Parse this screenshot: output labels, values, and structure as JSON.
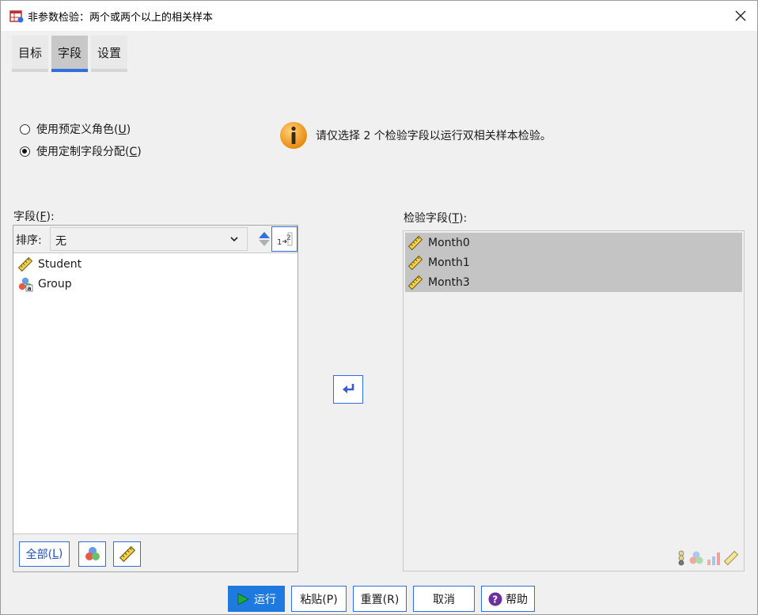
{
  "window": {
    "title": "非参数检验：两个或两个以上的相关样本"
  },
  "tabs": [
    {
      "label": "目标",
      "active": false
    },
    {
      "label": "字段",
      "active": true
    },
    {
      "label": "设置",
      "active": false
    }
  ],
  "roles": {
    "predefined_label": "使用预定义角色(",
    "predefined_key": "U",
    "custom_label": "使用定制字段分配(",
    "custom_key": "C",
    "selected": "custom"
  },
  "info": {
    "message": "请仅选择 2 个检验字段以运行双相关样本检验。"
  },
  "fields": {
    "label": "字段(",
    "key": "F",
    "sort_label": "排序:",
    "sort_value": "无",
    "items": [
      {
        "name": "Student",
        "icon": "scale-ruler-icon"
      },
      {
        "name": "Group",
        "icon": "nominal-string-icon"
      }
    ],
    "all_button": "全部(",
    "all_key": "L"
  },
  "test_fields": {
    "label": "检验字段(",
    "key": "T",
    "items": [
      {
        "name": "Month0",
        "icon": "scale-ruler-icon"
      },
      {
        "name": "Month1",
        "icon": "scale-ruler-icon"
      },
      {
        "name": "Month3",
        "icon": "scale-ruler-icon"
      }
    ]
  },
  "buttons": {
    "run": "运行",
    "paste": "粘贴(P)",
    "reset": "重置(R)",
    "cancel": "取消",
    "help": "帮助"
  },
  "colors": {
    "accent": "#2f6fe0",
    "primary_button": "#1f7ae0",
    "selected_row": "#c4c4c4",
    "info_orange": "#f0a020"
  }
}
